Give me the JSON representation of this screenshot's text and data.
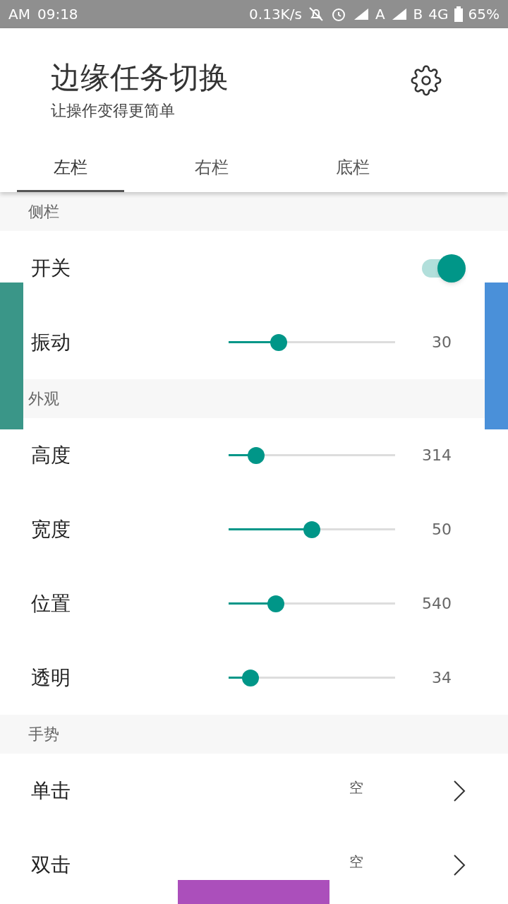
{
  "status_bar": {
    "time_prefix": "AM",
    "time": "09:18",
    "speed": "0.13K/s",
    "sim_a": "A",
    "sim_b": "B",
    "network": "4G",
    "battery": "65%"
  },
  "header": {
    "title": "边缘任务切换",
    "subtitle": "让操作变得更简单"
  },
  "tabs": [
    {
      "label": "左栏",
      "selected": true
    },
    {
      "label": "右栏",
      "selected": false
    },
    {
      "label": "底栏",
      "selected": false
    }
  ],
  "sections": [
    {
      "title": "侧栏",
      "rows": [
        {
          "kind": "switch",
          "label": "开关",
          "on": true
        },
        {
          "kind": "slider",
          "label": "振动",
          "level": 0.3,
          "reading": "30"
        }
      ]
    },
    {
      "title": "外观",
      "rows": [
        {
          "kind": "slider",
          "label": "高度",
          "level": 0.165,
          "reading": "314"
        },
        {
          "kind": "slider",
          "label": "宽度",
          "level": 0.5,
          "reading": "50"
        },
        {
          "kind": "slider",
          "label": "位置",
          "level": 0.285,
          "reading": "540"
        },
        {
          "kind": "slider",
          "label": "透明",
          "level": 0.13,
          "reading": "34"
        }
      ]
    },
    {
      "title": "手势",
      "rows": [
        {
          "kind": "link",
          "label": "单击",
          "value": "空"
        },
        {
          "kind": "link",
          "label": "双击",
          "value": "空"
        }
      ]
    }
  ],
  "edge_bars": [
    {
      "kind": "left",
      "color": "#3a9688"
    },
    {
      "kind": "right",
      "color": "#4a90d9"
    },
    {
      "kind": "bottom",
      "color": "#ab4fbb"
    }
  ]
}
